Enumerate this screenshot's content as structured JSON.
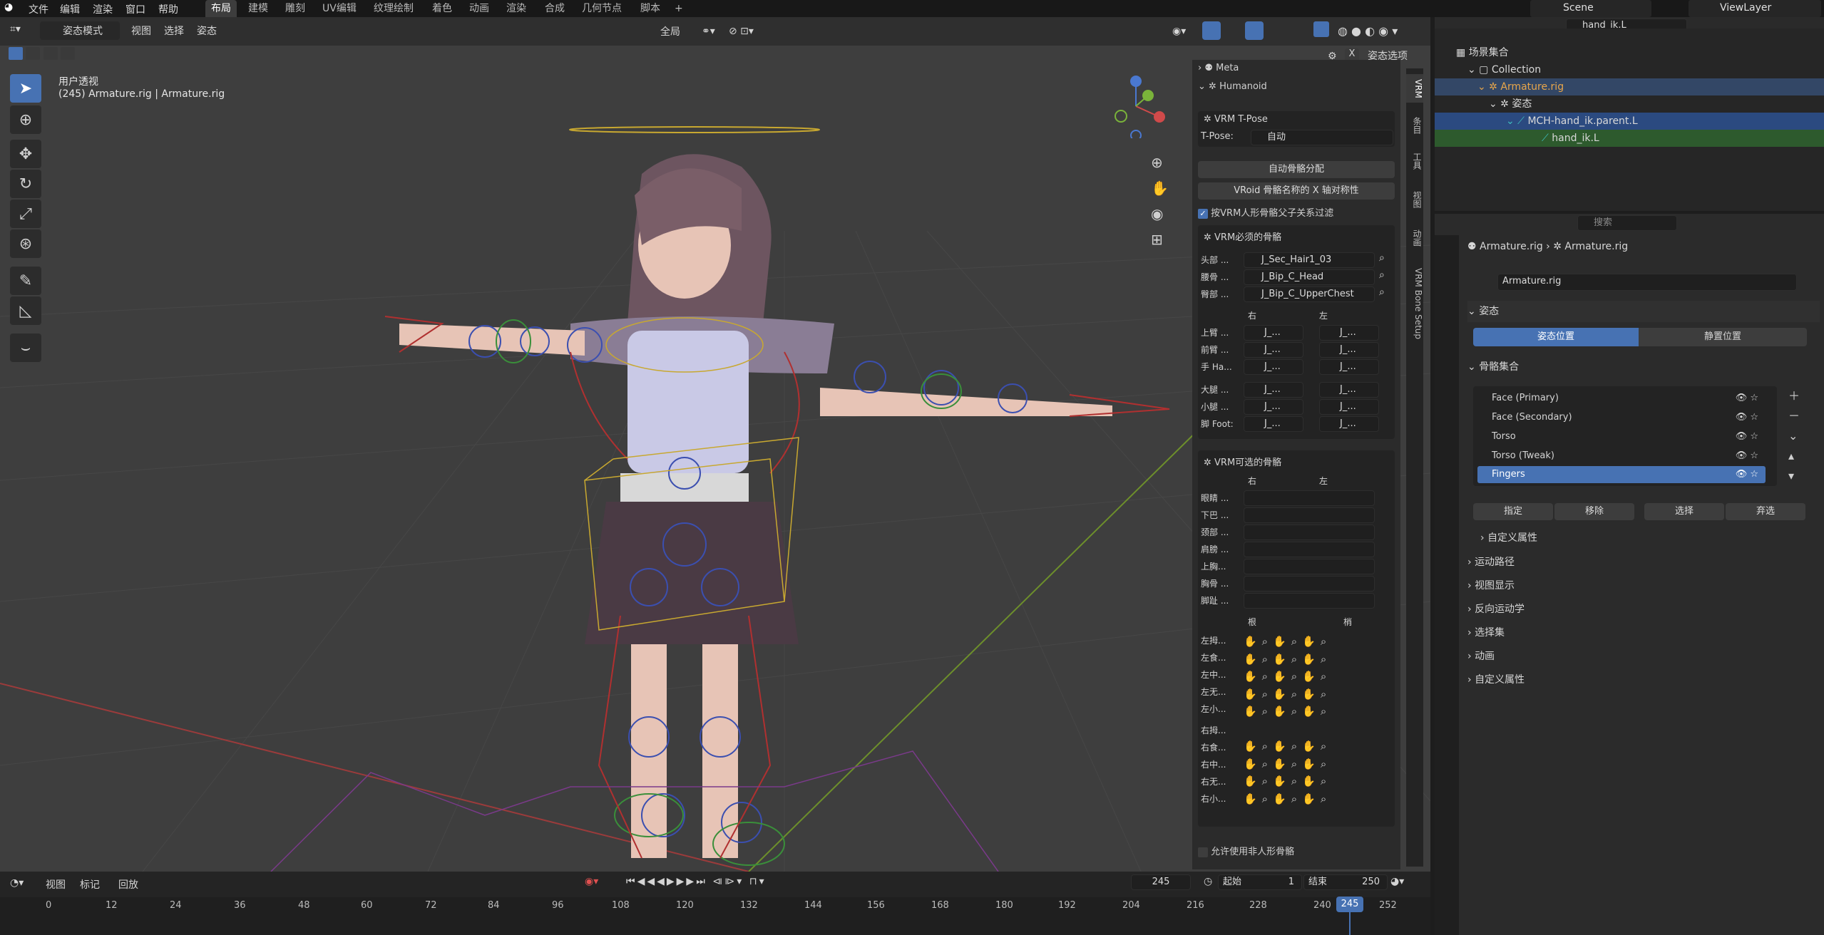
{
  "topbar": {
    "menus": [
      "文件",
      "编辑",
      "渲染",
      "窗口",
      "帮助"
    ],
    "workspaces": [
      "布局",
      "建模",
      "雕刻",
      "UV编辑",
      "纹理绘制",
      "着色",
      "动画",
      "渲染",
      "合成",
      "几何节点",
      "脚本"
    ],
    "active_workspace": "布局",
    "scene": "Scene",
    "view_layer": "ViewLayer"
  },
  "viewport_header": {
    "mode": "姿态模式",
    "menus": [
      "视图",
      "选择",
      "姿态"
    ],
    "transform_orientation": "全局",
    "pose_options": "姿态选项",
    "x_label": "X"
  },
  "viewport": {
    "view_name": "用户透视",
    "object_info": "(245) Armature.rig | Armature.rig"
  },
  "npanel": {
    "tabs": [
      "VRM",
      "条目",
      "工具",
      "视图",
      "动画",
      "VRM Bone Setup"
    ],
    "meta": "Meta",
    "humanoid": "Humanoid",
    "tpose_title": "VRM T-Pose",
    "tpose_label": "T-Pose:",
    "tpose_value": "自动",
    "auto_assign": "自动骨骼分配",
    "vroid_symmetry": "VRoid 骨骼名称的 X 轴对称性",
    "filter_label": "按VRM人形骨骼父子关系过滤",
    "required_title": "VRM必须的骨骼",
    "required": [
      {
        "label": "头部 ...",
        "value": "J_Sec_Hair1_03"
      },
      {
        "label": "腰骨 ...",
        "value": "J_Bip_C_Head"
      },
      {
        "label": "臀部 ...",
        "value": "J_Bip_C_UpperChest"
      }
    ],
    "right": "右",
    "left": "左",
    "limbs": [
      "上臂 ...",
      "前臂 ...",
      "手 Ha...",
      "大腿 ...",
      "小腿 ...",
      "脚 Foot:"
    ],
    "short_value": "J_...",
    "optional_title": "VRM可选的骨骼",
    "optional": [
      "眼睛 ...",
      "下巴 ...",
      "颈部 ...",
      "肩膀 ...",
      "上胸...",
      "胸骨 ...",
      "脚趾 ..."
    ],
    "root": "根",
    "tip": "梢",
    "fingers": [
      "左拇...",
      "左食...",
      "左中...",
      "左无...",
      "左小...",
      "右拇...",
      "右食...",
      "右中...",
      "右无...",
      "右小..."
    ],
    "allow_nonhuman": "允许使用非人形骨骼"
  },
  "outliner": {
    "search": "hand_ik.L",
    "items": [
      "场景集合",
      "Collection",
      "Armature.rig",
      "姿态",
      "MCH-hand_ik.parent.L",
      "hand_ik.L"
    ]
  },
  "properties": {
    "search_placeholder": "搜索",
    "breadcrumb": [
      "Armature.rig",
      "Armature.rig"
    ],
    "data_name": "Armature.rig",
    "pose_section": "姿态",
    "pose_position": "姿态位置",
    "rest_position": "静置位置",
    "bone_collections": "骨骼集合",
    "collections": [
      "Face (Primary)",
      "Face (Secondary)",
      "Torso",
      "Torso (Tweak)",
      "Fingers"
    ],
    "selected_collection": "Fingers",
    "actions": [
      "指定",
      "移除",
      "选择",
      "弃选"
    ],
    "custom_props_inner": "自定义属性",
    "sections": [
      "运动路径",
      "视图显示",
      "反向运动学",
      "选择集",
      "动画",
      "自定义属性"
    ]
  },
  "timeline": {
    "menus": [
      "视图",
      "标记",
      "回放"
    ],
    "current_frame": "245",
    "start_label": "起始",
    "start": "1",
    "end_label": "结束",
    "end": "250",
    "ticks": [
      "0",
      "12",
      "24",
      "36",
      "48",
      "60",
      "72",
      "84",
      "96",
      "108",
      "120",
      "132",
      "144",
      "156",
      "168",
      "180",
      "192",
      "204",
      "216",
      "228",
      "240",
      "252"
    ],
    "playhead": "245"
  },
  "colors": {
    "accent": "#4772b3",
    "selected_row": "#2b4a80",
    "hand_ik_row": "#2d5a2d",
    "armature_name": "#e8a64a"
  }
}
